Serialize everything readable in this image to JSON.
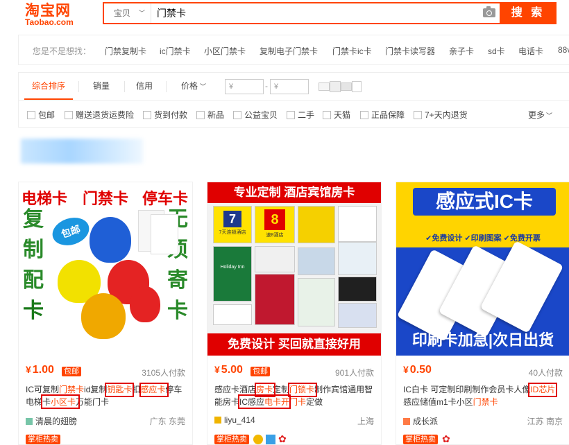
{
  "header": {
    "logo_cn": "淘宝网",
    "logo_en": "Taobao.com",
    "search": {
      "category": "宝贝",
      "query": "门禁卡",
      "button": "搜 索"
    }
  },
  "suggestions": {
    "label": "您是不是想找：",
    "items": [
      "门禁复制卡",
      "ic门禁卡",
      "小区门禁卡",
      "复制电子门禁卡",
      "门禁卡ic卡",
      "门禁卡读写器",
      "亲子卡",
      "sd卡",
      "电话卡",
      "88v"
    ]
  },
  "sort": {
    "tabs": [
      "综合排序",
      "销量",
      "信用",
      "价格"
    ],
    "price_min": "¥",
    "price_dash": "-",
    "price_max": "¥"
  },
  "filters": {
    "items": [
      "包邮",
      "赠送退货运费险",
      "货到付款",
      "新品",
      "公益宝贝",
      "二手",
      "天猫",
      "正品保障",
      "7+天内退货"
    ],
    "more": "更多"
  },
  "products": [
    {
      "price": "1.00",
      "yen": "¥",
      "baoyou": "包邮",
      "sales": "3105人付款",
      "title_line1": [
        "IC可复制",
        "门禁卡",
        "id复制",
        "钥匙卡",
        "扣",
        "感应卡",
        "停车"
      ],
      "title_line2": [
        "电梯卡",
        "小区卡",
        "万能门卡"
      ],
      "shop": "清晨的翅膀",
      "location": "广东 东莞",
      "hot": "掌柜热卖",
      "img_text": {
        "top": [
          "电梯卡",
          "门禁卡",
          "停车卡"
        ],
        "left": [
          "复",
          "制",
          "配",
          "卡"
        ],
        "right": [
          "无",
          "须",
          "寄",
          "卡"
        ],
        "badge": "包邮"
      }
    },
    {
      "price": "5.00",
      "yen": "¥",
      "baoyou": "包邮",
      "sales": "901人付款",
      "title_line1": [
        "感应卡酒店",
        "房卡",
        "定制",
        "门锁卡",
        "制作宾馆通用智"
      ],
      "title_line2": [
        "能房卡",
        "IC感应",
        "电卡开门卡",
        "定做"
      ],
      "shop": "liyu_414",
      "location": "上海",
      "hot": "掌柜热卖",
      "img_text": {
        "banner": "专业定制 酒店宾馆房卡",
        "foot": "免费设计 买回就直接好用",
        "c1": "7天连锁酒店",
        "c2": "速8酒店",
        "c3": "Holiday Inn"
      }
    },
    {
      "price": "0.50",
      "yen": "¥",
      "sales": "40人付款",
      "title_line1": [
        "IC白卡 可定制印刷制作会员卡人像",
        "ID芯片"
      ],
      "title_line2": [
        "感应储值m1卡小区",
        "门禁卡"
      ],
      "shop": "成长派",
      "location": "江苏 南京",
      "hot": "掌柜热卖",
      "img_text": {
        "head": "感应式IC卡",
        "bullets": "✔免费设计 ✔印刷图案 ✔免费开票",
        "foot": "印刷卡加急|次日出货"
      }
    }
  ],
  "colors": {
    "accent": "#ff4400",
    "highlight_box": "#e00000"
  }
}
